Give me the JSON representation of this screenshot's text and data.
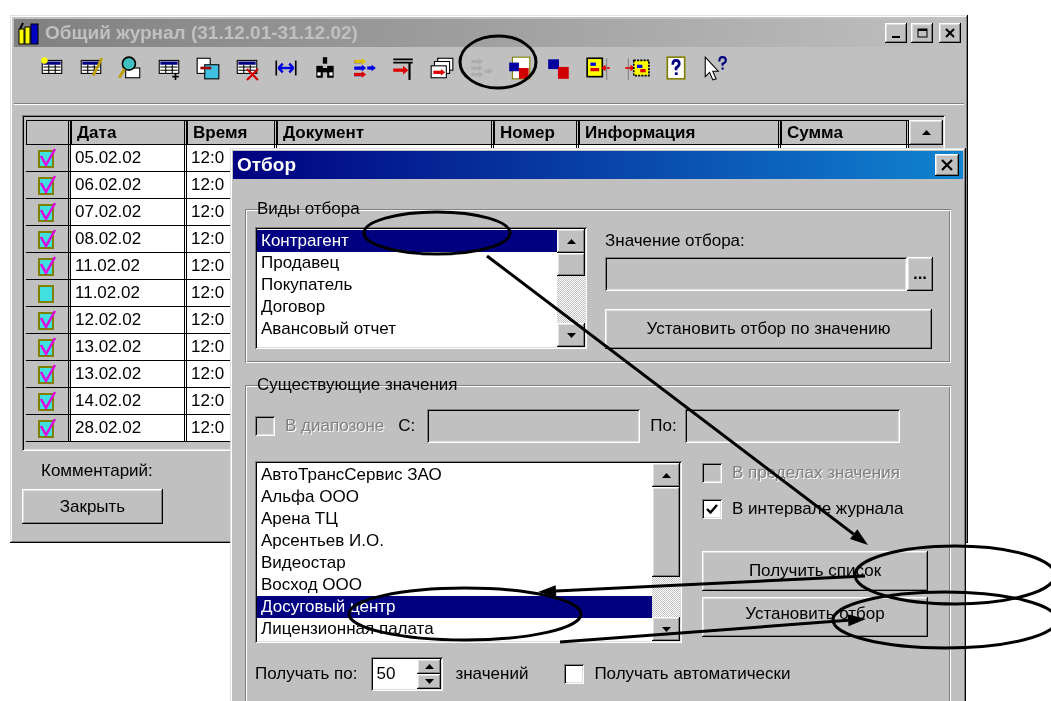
{
  "main_window": {
    "title": "Общий журнал (31.12.01-31.12.02)",
    "toolbar": [
      {
        "disabled": false
      },
      {
        "disabled": false
      },
      {
        "disabled": false
      },
      {
        "disabled": false
      },
      {
        "disabled": false
      },
      {
        "disabled": false
      },
      {
        "disabled": false
      },
      {
        "disabled": false
      },
      {
        "disabled": false
      },
      {
        "disabled": false
      },
      {
        "disabled": false
      },
      {
        "disabled": true
      },
      {
        "disabled": false
      },
      {
        "disabled": false
      },
      {
        "disabled": false
      },
      {
        "disabled": false
      },
      {
        "disabled": false
      },
      {
        "disabled": false
      }
    ],
    "table": {
      "columns": [
        "Дата",
        "Время",
        "Документ",
        "Номер",
        "Информация",
        "Сумма"
      ],
      "rows": [
        {
          "posted": true,
          "date": "05.02.02",
          "time": "12:0"
        },
        {
          "posted": true,
          "date": "06.02.02",
          "time": "12:0"
        },
        {
          "posted": true,
          "date": "07.02.02",
          "time": "12:0"
        },
        {
          "posted": true,
          "date": "08.02.02",
          "time": "12:0"
        },
        {
          "posted": true,
          "date": "11.02.02",
          "time": "12:0"
        },
        {
          "posted": false,
          "date": "11.02.02",
          "time": "12:0"
        },
        {
          "posted": true,
          "date": "12.02.02",
          "time": "12:0"
        },
        {
          "posted": true,
          "date": "13.02.02",
          "time": "12:0"
        },
        {
          "posted": true,
          "date": "13.02.02",
          "time": "12:0"
        },
        {
          "posted": true,
          "date": "14.02.02",
          "time": "12:0"
        },
        {
          "posted": true,
          "date": "28.02.02",
          "time": "12:0"
        }
      ]
    },
    "comment_label": "Комментарий:",
    "close_button": "Закрыть"
  },
  "dialog": {
    "title": "Отбор",
    "filter_types": {
      "legend": "Виды отбора",
      "items": [
        {
          "label": "Контрагент",
          "selected": true
        },
        {
          "label": "Продавец",
          "selected": false
        },
        {
          "label": "Покупатель",
          "selected": false
        },
        {
          "label": "Договор",
          "selected": false
        },
        {
          "label": "Авансовый отчет",
          "selected": false
        }
      ],
      "value_label": "Значение отбора:",
      "value_field": {
        "disabled": true
      },
      "browse_button": "...",
      "apply_value_button": "Установить отбор по значению"
    },
    "existing_values": {
      "legend": "Существующие значения",
      "range_checkbox": {
        "label": "В диапозоне",
        "checked": false,
        "disabled": true
      },
      "from_label": "С:",
      "from_field": {
        "disabled": true
      },
      "to_label": "По:",
      "to_field": {
        "disabled": true
      },
      "items": [
        {
          "label": "АвтоТрансСервис ЗАО",
          "selected": false
        },
        {
          "label": "Альфа ООО",
          "selected": false
        },
        {
          "label": "Арена ТЦ",
          "selected": false
        },
        {
          "label": "Арсентьев И.О.",
          "selected": false
        },
        {
          "label": "Видеостар",
          "selected": false
        },
        {
          "label": "Восход ООО",
          "selected": false
        },
        {
          "label": "Досуговый центр",
          "selected": true
        },
        {
          "label": "Лицензионная палата",
          "selected": false
        }
      ],
      "options": [
        {
          "label": "В пределах значения",
          "checked": false,
          "disabled": true
        },
        {
          "label": "В интервале журнала",
          "checked": true,
          "disabled": false
        }
      ],
      "get_list_button": "Получить список",
      "apply_button": "Установить отбор",
      "fetch_label": "Получать по:",
      "fetch_count": "50",
      "fetch_unit": "значений",
      "auto_checkbox": {
        "label": "Получать автоматически",
        "checked": false,
        "disabled": false
      }
    }
  }
}
